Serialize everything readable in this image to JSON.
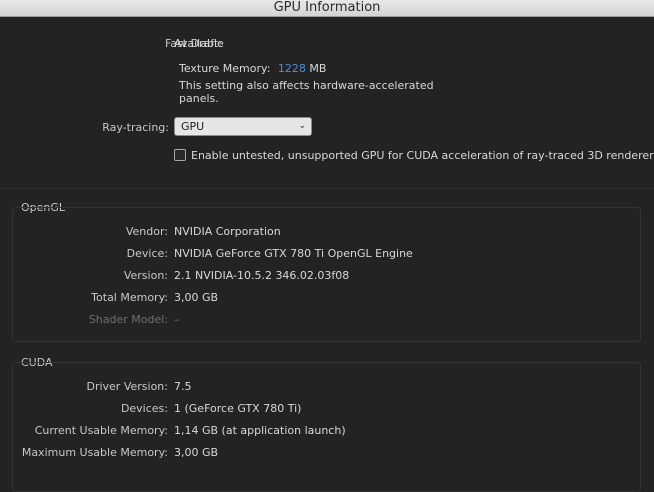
{
  "window": {
    "title": "GPU Information"
  },
  "fast_draft": {
    "label": "Fast Draft:",
    "value": "Available",
    "texture_memory_label": "Texture Memory:",
    "texture_memory_value": "1228",
    "texture_memory_unit": "MB",
    "note_line1": "This setting also affects hardware-accelerated",
    "note_line2": "panels."
  },
  "ray_tracing": {
    "label": "Ray-tracing:",
    "selected": "GPU",
    "checkbox_label": "Enable untested, unsupported GPU for CUDA acceleration of ray-traced 3D renderer",
    "checkbox_checked": false
  },
  "opengl": {
    "title": "OpenGL",
    "rows": [
      {
        "label": "Vendor:",
        "value": "NVIDIA Corporation"
      },
      {
        "label": "Device:",
        "value": "NVIDIA GeForce GTX 780 Ti OpenGL Engine"
      },
      {
        "label": "Version:",
        "value": "2.1 NVIDIA-10.5.2 346.02.03f08"
      },
      {
        "label": "Total Memory:",
        "value": "3,00 GB"
      },
      {
        "label": "Shader Model:",
        "value": "–"
      }
    ]
  },
  "cuda": {
    "title": "CUDA",
    "rows": [
      {
        "label": "Driver Version:",
        "value": "7.5"
      },
      {
        "label": "Devices:",
        "value": "1 (GeForce GTX 780 Ti)"
      },
      {
        "label": "Current Usable Memory:",
        "value": "1,14 GB (at application launch)"
      },
      {
        "label": "Maximum Usable Memory:",
        "value": "3,00 GB"
      }
    ]
  },
  "colors": {
    "background": "#232323",
    "text": "#c8c8c8",
    "accent": "#4a90d9",
    "disabled": "#6f6f6f"
  }
}
